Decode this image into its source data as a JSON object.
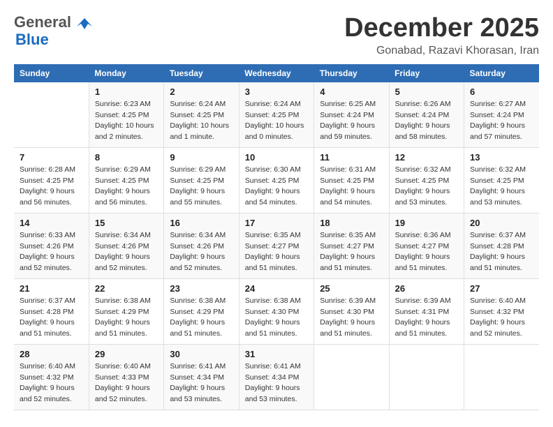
{
  "header": {
    "logo_line1": "General",
    "logo_line2": "Blue",
    "month_title": "December 2025",
    "location": "Gonabad, Razavi Khorasan, Iran"
  },
  "columns": [
    "Sunday",
    "Monday",
    "Tuesday",
    "Wednesday",
    "Thursday",
    "Friday",
    "Saturday"
  ],
  "weeks": [
    [
      {
        "day": "",
        "info": ""
      },
      {
        "day": "1",
        "info": "Sunrise: 6:23 AM\nSunset: 4:25 PM\nDaylight: 10 hours\nand 2 minutes."
      },
      {
        "day": "2",
        "info": "Sunrise: 6:24 AM\nSunset: 4:25 PM\nDaylight: 10 hours\nand 1 minute."
      },
      {
        "day": "3",
        "info": "Sunrise: 6:24 AM\nSunset: 4:25 PM\nDaylight: 10 hours\nand 0 minutes."
      },
      {
        "day": "4",
        "info": "Sunrise: 6:25 AM\nSunset: 4:24 PM\nDaylight: 9 hours\nand 59 minutes."
      },
      {
        "day": "5",
        "info": "Sunrise: 6:26 AM\nSunset: 4:24 PM\nDaylight: 9 hours\nand 58 minutes."
      },
      {
        "day": "6",
        "info": "Sunrise: 6:27 AM\nSunset: 4:24 PM\nDaylight: 9 hours\nand 57 minutes."
      }
    ],
    [
      {
        "day": "7",
        "info": "Sunrise: 6:28 AM\nSunset: 4:25 PM\nDaylight: 9 hours\nand 56 minutes."
      },
      {
        "day": "8",
        "info": "Sunrise: 6:29 AM\nSunset: 4:25 PM\nDaylight: 9 hours\nand 56 minutes."
      },
      {
        "day": "9",
        "info": "Sunrise: 6:29 AM\nSunset: 4:25 PM\nDaylight: 9 hours\nand 55 minutes."
      },
      {
        "day": "10",
        "info": "Sunrise: 6:30 AM\nSunset: 4:25 PM\nDaylight: 9 hours\nand 54 minutes."
      },
      {
        "day": "11",
        "info": "Sunrise: 6:31 AM\nSunset: 4:25 PM\nDaylight: 9 hours\nand 54 minutes."
      },
      {
        "day": "12",
        "info": "Sunrise: 6:32 AM\nSunset: 4:25 PM\nDaylight: 9 hours\nand 53 minutes."
      },
      {
        "day": "13",
        "info": "Sunrise: 6:32 AM\nSunset: 4:25 PM\nDaylight: 9 hours\nand 53 minutes."
      }
    ],
    [
      {
        "day": "14",
        "info": "Sunrise: 6:33 AM\nSunset: 4:26 PM\nDaylight: 9 hours\nand 52 minutes."
      },
      {
        "day": "15",
        "info": "Sunrise: 6:34 AM\nSunset: 4:26 PM\nDaylight: 9 hours\nand 52 minutes."
      },
      {
        "day": "16",
        "info": "Sunrise: 6:34 AM\nSunset: 4:26 PM\nDaylight: 9 hours\nand 52 minutes."
      },
      {
        "day": "17",
        "info": "Sunrise: 6:35 AM\nSunset: 4:27 PM\nDaylight: 9 hours\nand 51 minutes."
      },
      {
        "day": "18",
        "info": "Sunrise: 6:35 AM\nSunset: 4:27 PM\nDaylight: 9 hours\nand 51 minutes."
      },
      {
        "day": "19",
        "info": "Sunrise: 6:36 AM\nSunset: 4:27 PM\nDaylight: 9 hours\nand 51 minutes."
      },
      {
        "day": "20",
        "info": "Sunrise: 6:37 AM\nSunset: 4:28 PM\nDaylight: 9 hours\nand 51 minutes."
      }
    ],
    [
      {
        "day": "21",
        "info": "Sunrise: 6:37 AM\nSunset: 4:28 PM\nDaylight: 9 hours\nand 51 minutes."
      },
      {
        "day": "22",
        "info": "Sunrise: 6:38 AM\nSunset: 4:29 PM\nDaylight: 9 hours\nand 51 minutes."
      },
      {
        "day": "23",
        "info": "Sunrise: 6:38 AM\nSunset: 4:29 PM\nDaylight: 9 hours\nand 51 minutes."
      },
      {
        "day": "24",
        "info": "Sunrise: 6:38 AM\nSunset: 4:30 PM\nDaylight: 9 hours\nand 51 minutes."
      },
      {
        "day": "25",
        "info": "Sunrise: 6:39 AM\nSunset: 4:30 PM\nDaylight: 9 hours\nand 51 minutes."
      },
      {
        "day": "26",
        "info": "Sunrise: 6:39 AM\nSunset: 4:31 PM\nDaylight: 9 hours\nand 51 minutes."
      },
      {
        "day": "27",
        "info": "Sunrise: 6:40 AM\nSunset: 4:32 PM\nDaylight: 9 hours\nand 52 minutes."
      }
    ],
    [
      {
        "day": "28",
        "info": "Sunrise: 6:40 AM\nSunset: 4:32 PM\nDaylight: 9 hours\nand 52 minutes."
      },
      {
        "day": "29",
        "info": "Sunrise: 6:40 AM\nSunset: 4:33 PM\nDaylight: 9 hours\nand 52 minutes."
      },
      {
        "day": "30",
        "info": "Sunrise: 6:41 AM\nSunset: 4:34 PM\nDaylight: 9 hours\nand 53 minutes."
      },
      {
        "day": "31",
        "info": "Sunrise: 6:41 AM\nSunset: 4:34 PM\nDaylight: 9 hours\nand 53 minutes."
      },
      {
        "day": "",
        "info": ""
      },
      {
        "day": "",
        "info": ""
      },
      {
        "day": "",
        "info": ""
      }
    ]
  ]
}
